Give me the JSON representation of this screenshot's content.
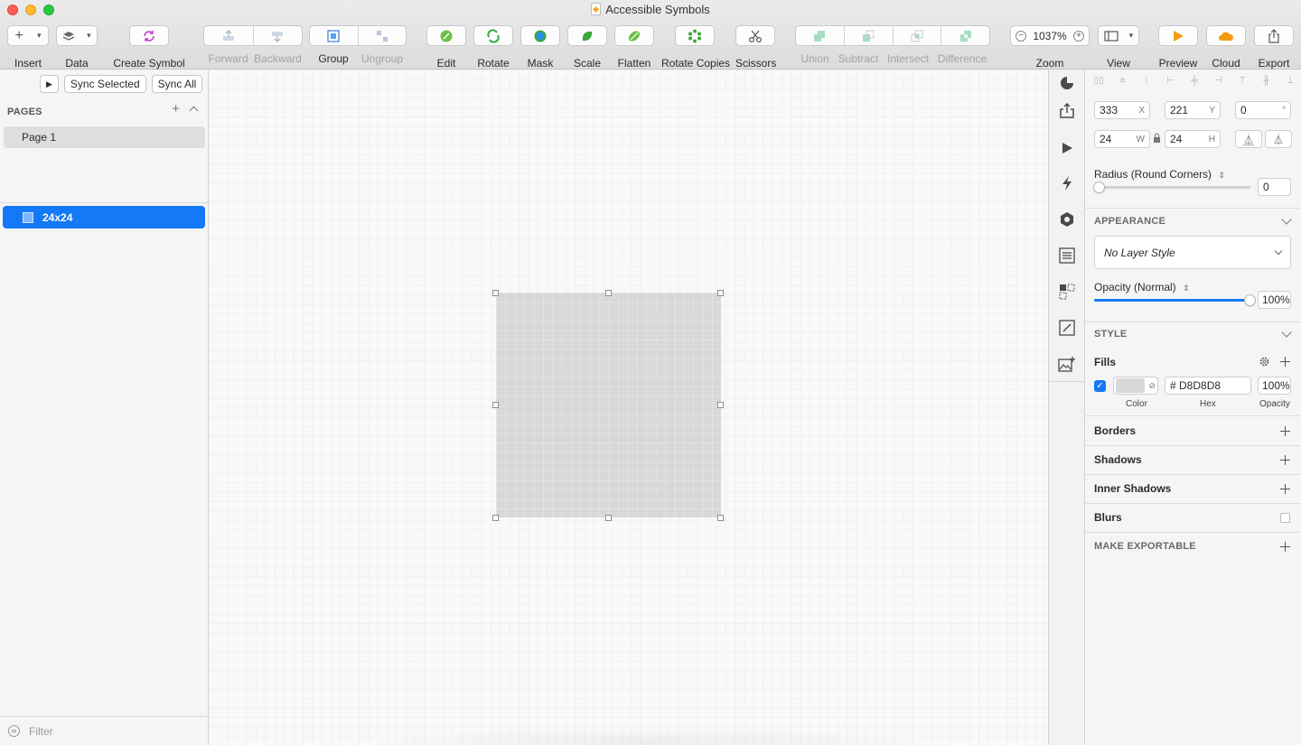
{
  "window": {
    "title": "Accessible Symbols"
  },
  "toolbar": {
    "insert": "Insert",
    "data": "Data",
    "create_symbol": "Create Symbol",
    "forward": "Forward",
    "backward": "Backward",
    "group": "Group",
    "ungroup": "Ungroup",
    "edit": "Edit",
    "rotate": "Rotate",
    "mask": "Mask",
    "scale": "Scale",
    "flatten": "Flatten",
    "rotate_copies": "Rotate Copies",
    "scissors": "Scissors",
    "union": "Union",
    "subtract": "Subtract",
    "intersect": "Intersect",
    "difference": "Difference",
    "zoom_label": "Zoom",
    "zoom_value": "1037%",
    "view": "View",
    "preview": "Preview",
    "cloud": "Cloud",
    "export": "Export"
  },
  "sidebar": {
    "sync_selected": "Sync Selected",
    "sync_all": "Sync All",
    "pages_header": "PAGES",
    "pages": [
      "Page 1"
    ],
    "layers": [
      "24x24"
    ],
    "filter_placeholder": "Filter"
  },
  "inspector": {
    "x": "333",
    "x_suffix": "X",
    "y": "221",
    "y_suffix": "Y",
    "rotation": "0",
    "rotation_suffix": "°",
    "w": "24",
    "w_suffix": "W",
    "h": "24",
    "h_suffix": "H",
    "radius_label": "Radius (Round Corners)",
    "radius_value": "0",
    "appearance_header": "APPEARANCE",
    "layer_style": "No Layer Style",
    "opacity_label": "Opacity (Normal)",
    "opacity_value": "100%",
    "opacity_level": 1.0,
    "style_header": "STYLE",
    "fills_label": "Fills",
    "fill_hex": "# D8D8D8",
    "fill_opacity": "100%",
    "fill_color": "#D8D8D8",
    "col_color": "Color",
    "col_hex": "Hex",
    "col_opacity": "Opacity",
    "borders": "Borders",
    "shadows": "Shadows",
    "inner_shadows": "Inner Shadows",
    "blurs": "Blurs",
    "make_exportable": "MAKE EXPORTABLE"
  },
  "colors": {
    "accent": "#1379F6",
    "artboard": "#D8D8D8"
  }
}
